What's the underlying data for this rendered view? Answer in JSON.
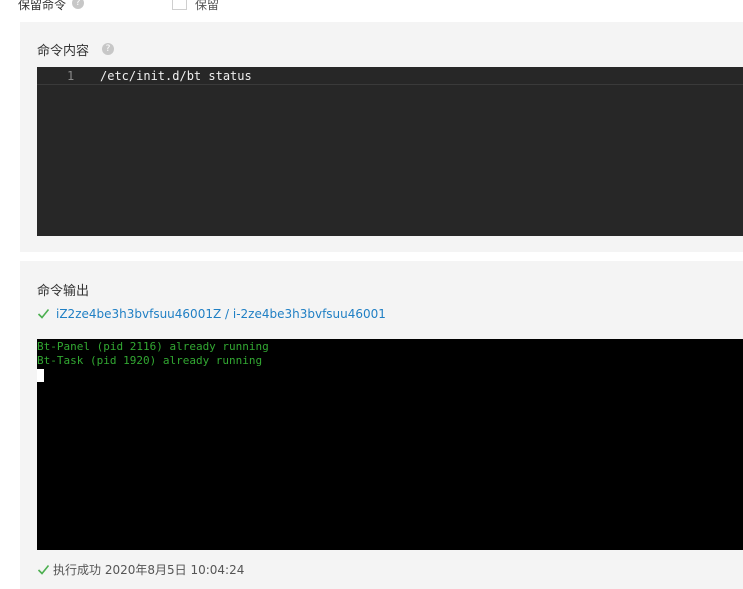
{
  "keep_command": {
    "label": "保留命令",
    "help": "?",
    "checkbox_label": "保留"
  },
  "command_content": {
    "title": "命令内容",
    "help": "?",
    "lines": [
      {
        "number": "1",
        "text": "/etc/init.d/bt status"
      }
    ]
  },
  "command_output": {
    "title": "命令输出",
    "instance": "iZ2ze4be3h3bvfsuu46001Z / i-2ze4be3h3bvfsuu46001",
    "terminal_lines": [
      "Bt-Panel (pid 2116) already running",
      "Bt-Task (pid 1920) already running"
    ],
    "status_text": "执行成功",
    "status_time": "2020年8月5日 10:04:24"
  },
  "colors": {
    "success_green": "#4caf50",
    "link_blue": "#1f7fc4",
    "terminal_green": "#32a832"
  }
}
